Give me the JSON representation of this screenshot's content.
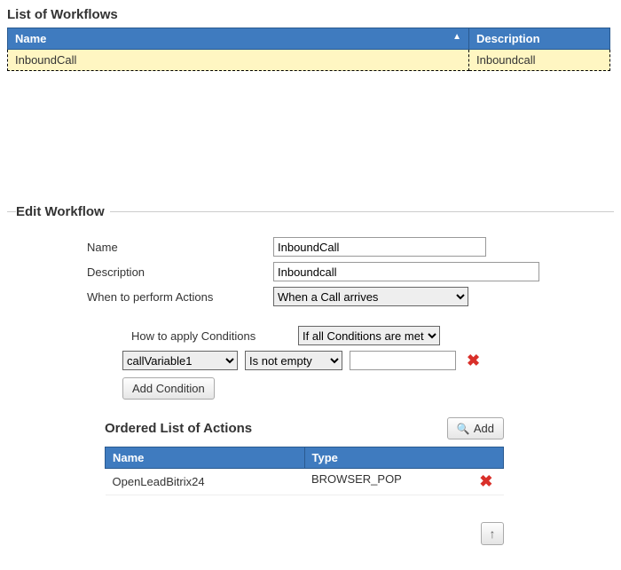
{
  "list": {
    "title": "List of Workflows",
    "columns": {
      "name": "Name",
      "description": "Description"
    },
    "rows": [
      {
        "name": "InboundCall",
        "description": "Inboundcall"
      }
    ]
  },
  "edit": {
    "legend": "Edit Workflow",
    "labels": {
      "name": "Name",
      "description": "Description",
      "when": "When to perform Actions",
      "howConditions": "How to apply Conditions"
    },
    "values": {
      "name": "InboundCall",
      "description": "Inboundcall",
      "when": "When a Call arrives",
      "howConditions": "If all Conditions are met"
    },
    "condition": {
      "variable": "callVariable1",
      "operator": "Is not empty",
      "value": ""
    },
    "buttons": {
      "addCondition": "Add Condition",
      "add": "Add"
    }
  },
  "actions": {
    "title": "Ordered List of Actions",
    "columns": {
      "name": "Name",
      "type": "Type"
    },
    "rows": [
      {
        "name": "OpenLeadBitrix24",
        "type": "BROWSER_POP"
      }
    ]
  }
}
